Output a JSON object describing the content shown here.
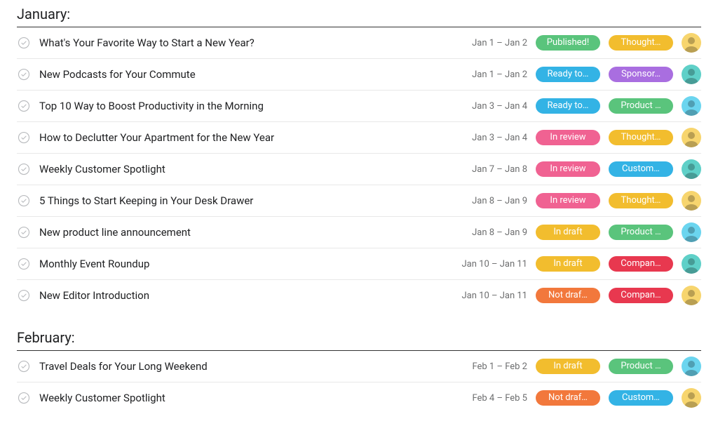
{
  "sections": [
    {
      "title": "January:",
      "tasks": [
        {
          "title": "What's Your Favorite Way to Start a New Year?",
          "date": "Jan 1 – Jan 2",
          "status": {
            "label": "Published!",
            "color": "green"
          },
          "category": {
            "label": "Thought…",
            "color": "yellow"
          },
          "avatar": "yellow"
        },
        {
          "title": "New Podcasts for Your Commute",
          "date": "Jan 1 – Jan 2",
          "status": {
            "label": "Ready to…",
            "color": "blue"
          },
          "category": {
            "label": "Sponsor…",
            "color": "purple"
          },
          "avatar": "teal"
        },
        {
          "title": "Top 10 Way to Boost Productivity in the Morning",
          "date": "Jan 3 – Jan 4",
          "status": {
            "label": "Ready to…",
            "color": "blue"
          },
          "category": {
            "label": "Product …",
            "color": "green"
          },
          "avatar": "cyan"
        },
        {
          "title": "How to Declutter Your Apartment for the New Year",
          "date": "Jan 3 – Jan 4",
          "status": {
            "label": "In review",
            "color": "pink"
          },
          "category": {
            "label": "Thought…",
            "color": "yellow"
          },
          "avatar": "yellow"
        },
        {
          "title": "Weekly Customer Spotlight",
          "date": "Jan 7 – Jan 8",
          "status": {
            "label": "In review",
            "color": "pink"
          },
          "category": {
            "label": "Custom…",
            "color": "blue"
          },
          "avatar": "teal"
        },
        {
          "title": "5 Things to Start Keeping in Your Desk Drawer",
          "date": "Jan 8 – Jan 9",
          "status": {
            "label": "In review",
            "color": "pink"
          },
          "category": {
            "label": "Thought…",
            "color": "yellow"
          },
          "avatar": "yellow"
        },
        {
          "title": "New product line announcement",
          "date": "Jan 8 – Jan 9",
          "status": {
            "label": "In draft",
            "color": "yellow"
          },
          "category": {
            "label": "Product …",
            "color": "green"
          },
          "avatar": "cyan"
        },
        {
          "title": "Monthly Event Roundup",
          "date": "Jan 10 – Jan 11",
          "status": {
            "label": "In draft",
            "color": "yellow"
          },
          "category": {
            "label": "Compan…",
            "color": "red"
          },
          "avatar": "teal"
        },
        {
          "title": "New Editor Introduction",
          "date": "Jan 10 – Jan 11",
          "status": {
            "label": "Not draf…",
            "color": "orange"
          },
          "category": {
            "label": "Compan…",
            "color": "red"
          },
          "avatar": "yellow"
        }
      ]
    },
    {
      "title": "February:",
      "tasks": [
        {
          "title": "Travel Deals for Your Long Weekend",
          "date": "Feb 1 – Feb 2",
          "status": {
            "label": "In draft",
            "color": "yellow"
          },
          "category": {
            "label": "Product …",
            "color": "green"
          },
          "avatar": "cyan"
        },
        {
          "title": "Weekly Customer Spotlight",
          "date": "Feb 4 – Feb 5",
          "status": {
            "label": "Not draf…",
            "color": "orange"
          },
          "category": {
            "label": "Custom…",
            "color": "blue"
          },
          "avatar": "yellow"
        }
      ]
    }
  ]
}
